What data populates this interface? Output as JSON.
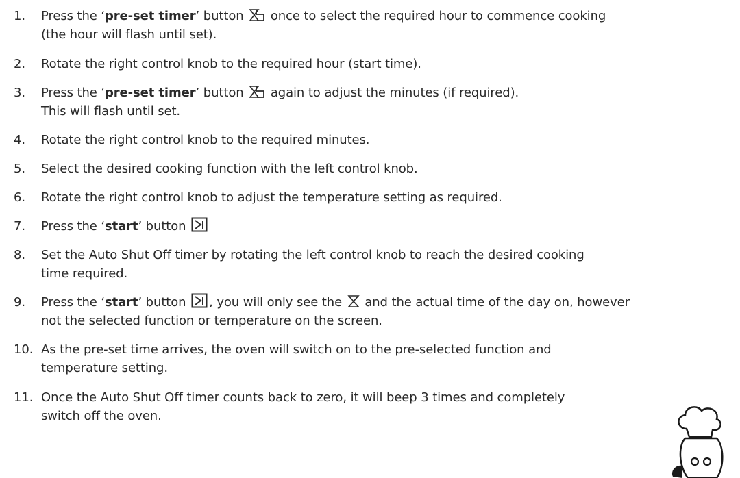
{
  "steps": [
    {
      "num": "1.",
      "line1_a": "Press the ‘",
      "line1_b": "pre-set timer",
      "line1_c": "’ button",
      "line1_d": "once to select the required hour to commence cooking",
      "line2": "(the hour will flash until set).",
      "icon": "preset-timer-icon"
    },
    {
      "num": "2.",
      "line1": "Rotate the right control knob to the required hour (start time)."
    },
    {
      "num": "3.",
      "line1_a": "Press the ‘",
      "line1_b": "pre-set timer",
      "line1_c": "’ button",
      "line1_d": "again to adjust the minutes (if required).",
      "line2": "This will flash until set.",
      "icon": "preset-timer-icon"
    },
    {
      "num": "4.",
      "line1": "Rotate the right control knob to the required minutes."
    },
    {
      "num": "5.",
      "line1": "Select the desired cooking function with the left control knob."
    },
    {
      "num": "6.",
      "line1": "Rotate the right control knob to adjust the temperature setting as required."
    },
    {
      "num": "7.",
      "line1_a": "Press the ‘",
      "line1_b": "start",
      "line1_c": "’ button",
      "icon": "start-icon"
    },
    {
      "num": "8.",
      "line1": "Set the Auto Shut Off timer by rotating the left control knob to reach the desired cooking",
      "line2": "time required."
    },
    {
      "num": "9.",
      "line1_a": "Press the ‘",
      "line1_b": "start",
      "line1_c": "’ button",
      "line1_d": ",  you will only see the",
      "line1_e": "and the actual time of the day on, however",
      "line2": "not the selected function or temperature on the screen.",
      "icon": "start-icon",
      "icon2": "hourglass-icon"
    },
    {
      "num": "10.",
      "line1": "As the pre-set time arrives, the oven will switch on to the pre-selected function and",
      "line2": "temperature setting."
    },
    {
      "num": "11.",
      "line1": "Once the Auto Shut Off timer counts back to zero, it will beep 3 times and completely",
      "line2": "switch off the oven."
    }
  ],
  "decoration": {
    "mascot": "chef-mascot-icon"
  }
}
